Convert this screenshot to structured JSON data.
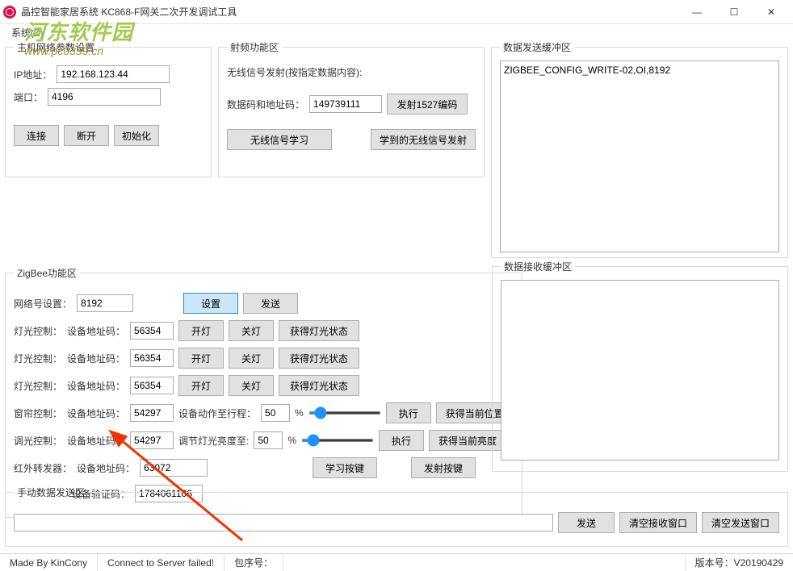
{
  "window": {
    "title": "晶控智能家居系统 KC868-F网关二次开发调试工具",
    "min": "—",
    "max": "☐",
    "close": "✕"
  },
  "menu": {
    "system": "系统(Z)"
  },
  "net": {
    "legend": "主机网络参数设置",
    "ip_label": "IP地址：",
    "ip": "192.168.123.44",
    "port_label": "端口：",
    "port": "4196",
    "connect": "连接",
    "disconnect": "断开",
    "init": "初始化"
  },
  "rf": {
    "legend": "射频功能区",
    "line1": "无线信号发射(按指定数据内容):",
    "code_label": "数据码和地址码：",
    "code": "149739111",
    "send1527": "发射1527编码",
    "learn": "无线信号学习",
    "emit": "学到的无线信号发射"
  },
  "txbuf": {
    "legend": "数据发送缓冲区",
    "content": "ZIGBEE_CONFIG_WRITE-02,OI,8192"
  },
  "rxbuf": {
    "legend": "数据接收缓冲区",
    "content": ""
  },
  "zigbee": {
    "legend": "ZigBee功能区",
    "netid_label": "网络号设置：",
    "netid": "8192",
    "set": "设置",
    "send": "发送",
    "light_label": "灯光控制：",
    "addr_label": "设备地址码：",
    "light_addr": "56354",
    "on": "开灯",
    "off": "关灯",
    "status": "获得灯光状态",
    "curtain_label": "窗帘控制：",
    "curtain_addr": "54297",
    "curtain_act": "设备动作至行程：",
    "curtain_pct": "50",
    "pct": "%",
    "exec": "执行",
    "curtain_get": "获得当前位置",
    "dim_label": "调光控制：",
    "dim_addr": "54297",
    "dim_act": "调节灯光亮度至:",
    "dim_pct": "50",
    "dim_get": "获得当前亮度",
    "ir_label": "红外转发器：",
    "ir_addr": "63072",
    "ir_verify_label": "设备验证码：",
    "ir_verify": "1784061106",
    "learn_key": "学习按键",
    "send_key": "发射按键"
  },
  "manual": {
    "legend": "手动数据发送区",
    "value": "",
    "send": "发送",
    "clear_rx": "清空接收窗口",
    "clear_tx": "清空发送窗口"
  },
  "status": {
    "made": "Made By KinCony",
    "conn": "Connect to Server failed!",
    "seq": "包序号：",
    "ver": "版本号：V20190429"
  },
  "watermark": {
    "title": "河东软件园",
    "url": "www.pc0359.cn"
  }
}
